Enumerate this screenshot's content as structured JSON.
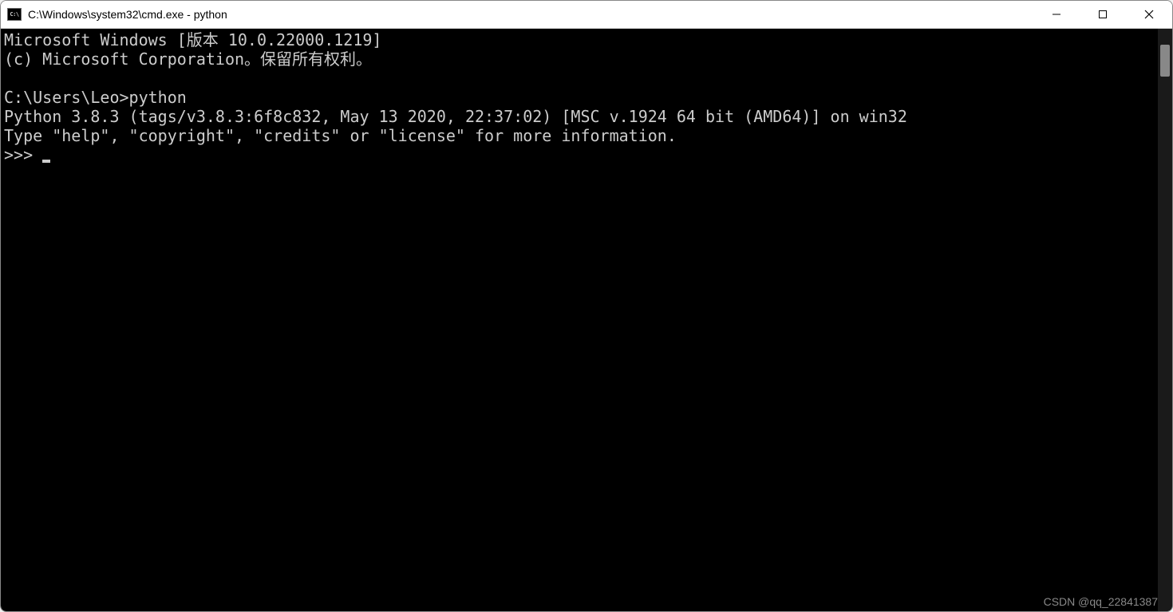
{
  "window": {
    "title": "C:\\Windows\\system32\\cmd.exe - python"
  },
  "terminal": {
    "line1": "Microsoft Windows [版本 10.0.22000.1219]",
    "line2": "(c) Microsoft Corporation。保留所有权利。",
    "line3": "",
    "prompt_path": "C:\\Users\\Leo>",
    "command": "python",
    "python_banner": "Python 3.8.3 (tags/v3.8.3:6f8c832, May 13 2020, 22:37:02) [MSC v.1924 64 bit (AMD64)] on win32",
    "python_help": "Type \"help\", \"copyright\", \"credits\" or \"license\" for more information.",
    "python_prompt": ">>> "
  },
  "watermark": "CSDN @qq_22841387"
}
